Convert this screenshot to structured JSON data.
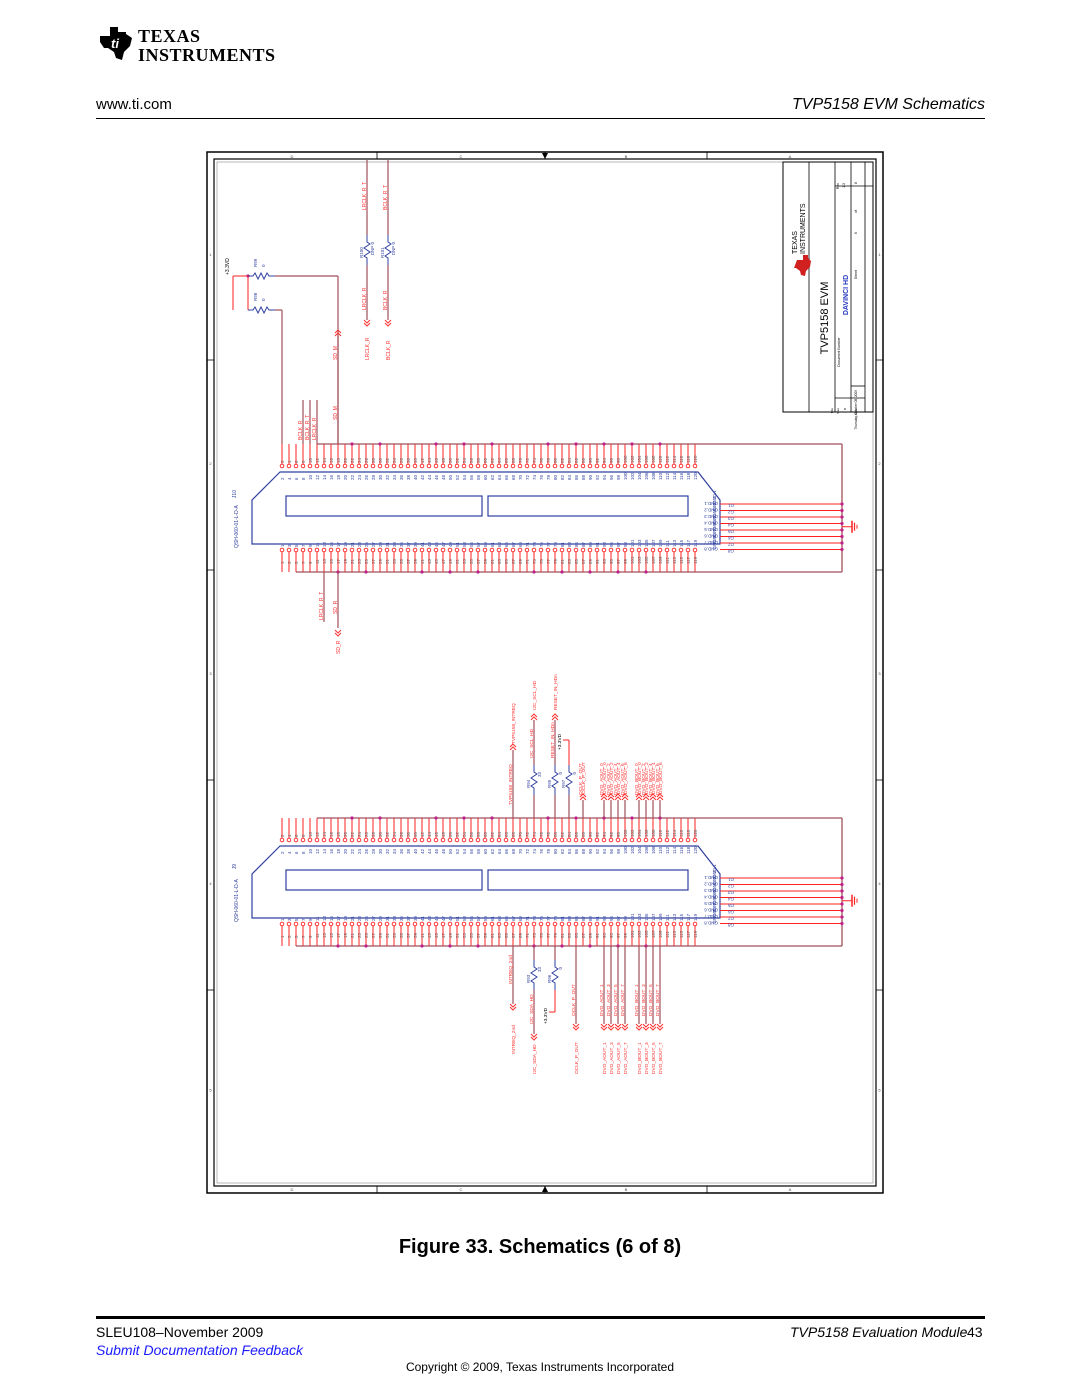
{
  "header": {
    "brand_line1": "Texas",
    "brand_line2": "Instruments",
    "site_url": "www.ti.com",
    "doc_section_title": "TVP5158 EVM Schematics"
  },
  "schematic": {
    "border_zone_columns": [
      "D",
      "C",
      "B",
      "A"
    ],
    "border_zone_rows": [
      "1",
      "2",
      "3",
      "4",
      "5"
    ],
    "title_block": {
      "brand_line1": "Texas",
      "brand_line2": "Instruments",
      "title_label": "Title",
      "title": "TVP5158 EVM",
      "size_label": "Size",
      "size": "B",
      "doc_number_label": "Document Number",
      "doc_number": "DAVINCI HD",
      "rev_label": "Rev",
      "rev": "1.3",
      "date_label": "Date:",
      "date": "Thursday, October 08, 2009",
      "sheet_label": "Sheet",
      "sheet": "6",
      "of_label": "of",
      "sheet_total": "8"
    },
    "power_label": "+3.3VD",
    "top_connector": {
      "refdes": "J10",
      "part": "QSH-060-01-L-D-A",
      "even_pins": [
        "2",
        "4",
        "6",
        "8",
        "10",
        "12",
        "14",
        "16",
        "18",
        "20",
        "22",
        "24",
        "26",
        "28",
        "30",
        "32",
        "34",
        "36",
        "38",
        "40",
        "42",
        "44",
        "46",
        "48",
        "50",
        "52",
        "54",
        "56",
        "58",
        "60",
        "62",
        "64",
        "66",
        "68",
        "70",
        "72",
        "74",
        "76",
        "78",
        "80",
        "82",
        "84",
        "86",
        "88",
        "90",
        "92",
        "94",
        "96",
        "98",
        "100",
        "102",
        "104",
        "106",
        "108",
        "110",
        "112",
        "114",
        "116",
        "118",
        "120"
      ],
      "odd_pins": [
        "1",
        "3",
        "5",
        "7",
        "9",
        "11",
        "13",
        "15",
        "17",
        "19",
        "21",
        "23",
        "25",
        "27",
        "29",
        "31",
        "33",
        "35",
        "37",
        "39",
        "41",
        "43",
        "45",
        "47",
        "49",
        "51",
        "53",
        "55",
        "57",
        "59",
        "61",
        "63",
        "65",
        "67",
        "69",
        "71",
        "73",
        "75",
        "77",
        "79",
        "81",
        "83",
        "85",
        "87",
        "89",
        "91",
        "93",
        "95",
        "97",
        "99",
        "101",
        "103",
        "105",
        "107",
        "109",
        "111",
        "113",
        "115",
        "117",
        "119"
      ],
      "gnd_pins": [
        "GND.1",
        "GND.2",
        "GND.3",
        "GND.4",
        "GND.5",
        "GND.6",
        "GND.7",
        "GND.8"
      ],
      "gnd_pin_ids": [
        "G1",
        "G2",
        "G3",
        "G4",
        "G5",
        "G6",
        "G7",
        "G8"
      ],
      "even_side_nets": [
        "BCLK_R",
        "BCLK_R_T",
        "LRCLK_R",
        "SD_M"
      ],
      "odd_side_nets": [
        "LRCLK_R_T",
        "SD_R"
      ],
      "offpage_in": [
        "SD_M",
        "LRCLK_R",
        "BCLK_R"
      ],
      "offpage_out": [
        "SD_R"
      ]
    },
    "top_resistors": [
      {
        "ref": "R99",
        "value": "0"
      },
      {
        "ref": "R98",
        "value": "0"
      },
      {
        "ref": "R100",
        "value": "DNP 0",
        "net_a": "LRCLK_R",
        "net_b": "LRCLK_R_T"
      },
      {
        "ref": "R101",
        "value": "DNP 0",
        "net_a": "BCLK_R",
        "net_b": "BCLK_R_T"
      }
    ],
    "bottom_connector": {
      "refdes": "J9",
      "part": "QSH-060-01-L-D-A",
      "gnd_pins": [
        "GND.1",
        "GND.2",
        "GND.3",
        "GND.4",
        "GND.5",
        "GND.6",
        "GND.7",
        "GND.8"
      ],
      "gnd_pin_ids": [
        "G1",
        "G2",
        "G3",
        "G4",
        "G5",
        "G6",
        "G7",
        "G8"
      ],
      "even_side_nets": [
        "TVP5158_INTREQ",
        "I2C_SCL_HD",
        "RESET_IN_HDn",
        "OCLK_P_OUT",
        "DVO_AOUT_0",
        "DVO_AOUT_2",
        "DVO_AOUT_4",
        "DVO_AOUT_6",
        "DVO_BOUT_0",
        "DVO_BOUT_2",
        "DVO_BOUT_4",
        "DVO_BOUT_6"
      ],
      "even_offpage": [
        "TVP5158_INTREQ",
        "I2C_SCL_HD",
        "RESET_IN_HDn",
        "OCLK_P_OUT",
        "DVO_AOUT_0",
        "DVO_AOUT_2",
        "DVO_AOUT_4",
        "DVO_AOUT_6",
        "DVO_BOUT_0",
        "DVO_BOUT_2",
        "DVO_BOUT_4",
        "DVO_BOUT_6"
      ],
      "odd_side_nets": [
        "INTREQ_2nd",
        "I2C_SDA_HD",
        "OCLK_P_OUT",
        "DVO_AOUT_1",
        "DVO_AOUT_3",
        "DVO_AOUT_5",
        "DVO_AOUT_7",
        "DVO_BOUT_1",
        "DVO_BOUT_3",
        "DVO_BOUT_5",
        "DVO_BOUT_7"
      ],
      "odd_offpage": [
        "INTREQ_2nd",
        "I2C_SDA_HD",
        "OCLK_P_OUT",
        "DVO_AOUT_1",
        "DVO_AOUT_3",
        "DVO_AOUT_5",
        "DVO_AOUT_7",
        "DVO_BOUT_1",
        "DVO_BOUT_3",
        "DVO_BOUT_5",
        "DVO_BOUT_7"
      ]
    },
    "bottom_resistors": [
      {
        "ref": "R94",
        "value": "33"
      },
      {
        "ref": "R95",
        "value": "0"
      },
      {
        "ref": "R97",
        "value": "0"
      },
      {
        "ref": "R93",
        "value": "33"
      },
      {
        "ref": "R96",
        "value": "0"
      }
    ]
  },
  "figure": {
    "caption": "Figure 33. Schematics (6 of 8)"
  },
  "footer": {
    "doc_id": "SLEU108–November 2009",
    "module_name": "TVP5158 Evaluation Module",
    "page_number": "43",
    "feedback_link": "Submit Documentation Feedback",
    "copyright": "Copyright © 2009, Texas Instruments Incorporated"
  },
  "colors": {
    "wire": "#a0505a",
    "pin": "#ff2020",
    "symbol": "#3040a0",
    "net_label": "#ff3030",
    "junction": "#c0208a",
    "title_accent": "#2a3cc0"
  }
}
